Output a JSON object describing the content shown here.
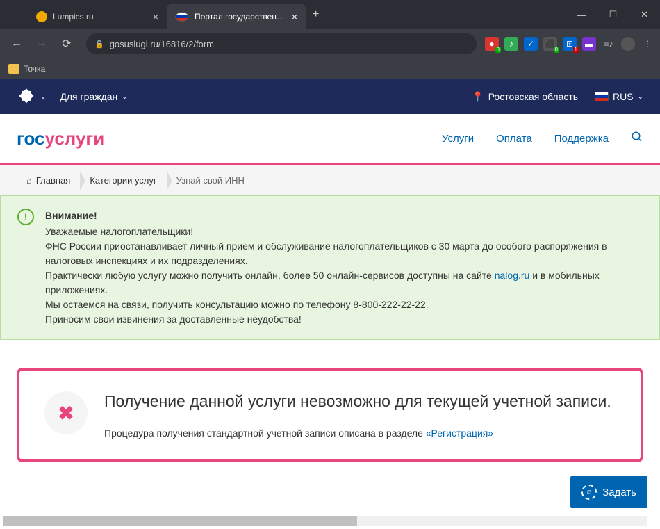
{
  "browser": {
    "tabs": [
      {
        "title": "Lumpics.ru",
        "favicon_color": "#f2a900"
      },
      {
        "title": "Портал государственных услуг I",
        "favicon_flag": true
      }
    ],
    "url": "gosuslugi.ru/16816/2/form",
    "bookmark": "Точка",
    "ext_badge": "0"
  },
  "topnav": {
    "audience": "Для граждан",
    "region": "Ростовская область",
    "lang": "RUS"
  },
  "header": {
    "logo_gos": "гос",
    "logo_uslugi": "услуги",
    "links": {
      "services": "Услуги",
      "payment": "Оплата",
      "support": "Поддержка"
    }
  },
  "breadcrumb": {
    "home": "Главная",
    "categories": "Категории услуг",
    "current": "Узнай свой ИНН"
  },
  "alert": {
    "title": "Внимание!",
    "line1": "Уважаемые налогоплательщики!",
    "line2": "ФНС России приостанавливает личный прием и обслуживание налогоплательщиков с 30 марта до особого распоряжения в налоговых инспекциях и их подразделениях.",
    "line3a": "Практически любую услугу можно получить онлайн, более 50 онлайн-сервисов доступны на сайте ",
    "line3_link": "nalog.ru",
    "line3b": " и в мобильных приложениях.",
    "line4": "Мы остаемся на связи, получить консультацию можно по телефону 8-800-222-22-22.",
    "line5": "Приносим свои извинения за доставленные неудобства!"
  },
  "error": {
    "title": "Получение данной услуги невозможно для текущей учетной записи.",
    "text": "Процедура получения стандартной учетной записи описана в разделе ",
    "link": "«Регистрация»"
  },
  "ask_button": "Задать"
}
